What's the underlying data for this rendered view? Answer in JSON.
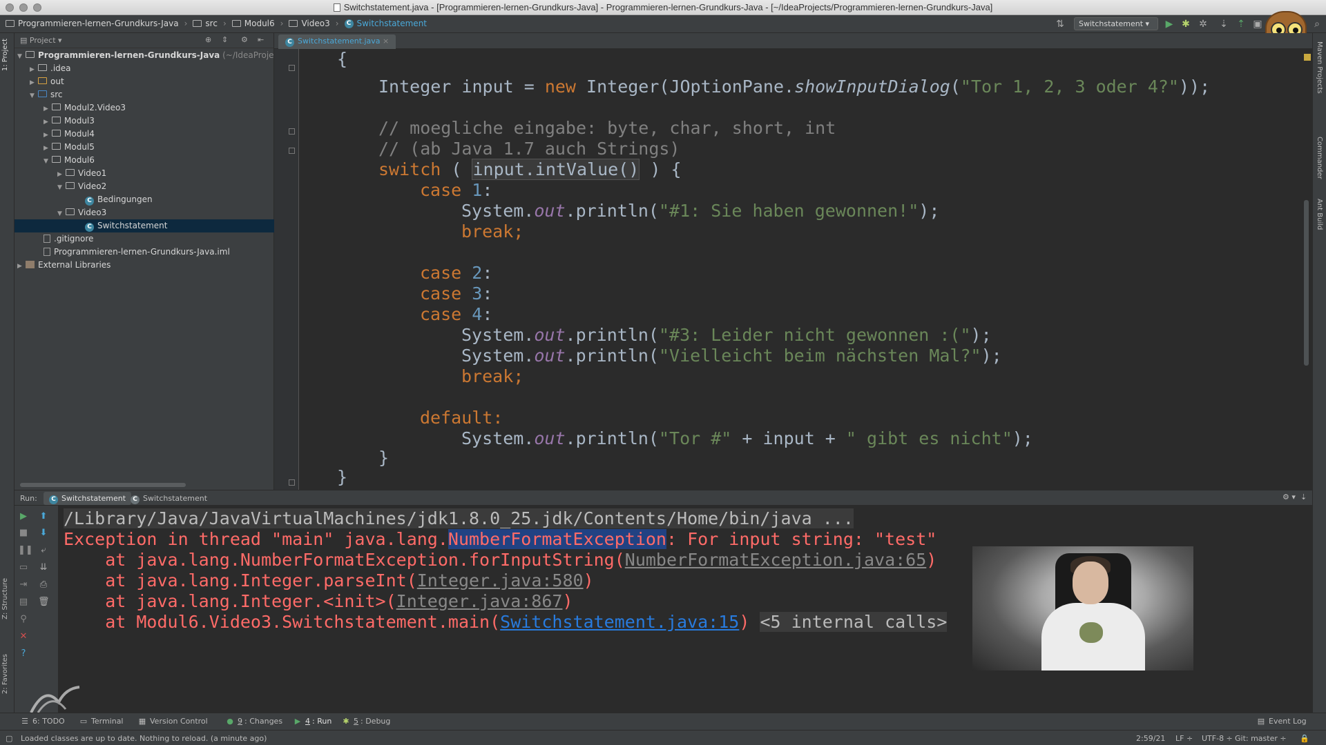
{
  "window": {
    "title": "Switchstatement.java - [Programmieren-lernen-Grundkurs-Java] - Programmieren-lernen-Grundkurs-Java - [~/IdeaProjects/Programmieren-lernen-Grundkurs-Java]"
  },
  "navbar": {
    "crumbs": [
      "Programmieren-lernen-Grundkurs-Java",
      "src",
      "Modul6",
      "Video3",
      "Switchstatement"
    ],
    "run_config": "Switchstatement"
  },
  "left_strip": {
    "project_tab": "1: Project",
    "structure_tab": "Z: Structure",
    "favorites_tab": "2: Favorites"
  },
  "right_strip": {
    "maven_tab": "Maven Projects",
    "commander_tab": "Commander",
    "ant_tab": "Ant Build"
  },
  "project": {
    "header": "Project",
    "root_name": "Programmieren-lernen-Grundkurs-Java",
    "root_path": "(~/IdeaProjec",
    "items": [
      {
        "label": ".idea"
      },
      {
        "label": "out"
      },
      {
        "label": "src"
      },
      {
        "label": "Modul2.Video3"
      },
      {
        "label": "Modul3"
      },
      {
        "label": "Modul4"
      },
      {
        "label": "Modul5"
      },
      {
        "label": "Modul6"
      },
      {
        "label": "Video1"
      },
      {
        "label": "Video2"
      },
      {
        "label": "Bedingungen"
      },
      {
        "label": "Video3"
      },
      {
        "label": "Switchstatement"
      },
      {
        "label": ".gitignore"
      },
      {
        "label": "Programmieren-lernen-Grundkurs-Java.iml"
      },
      {
        "label": "External Libraries"
      }
    ]
  },
  "editor": {
    "tab": "Switchstatement.java",
    "lines": {
      "l0": "{",
      "l1a": "Integer input = ",
      "l1b": "new",
      "l1c": " Integer(JOptionPane.",
      "l1d": "showInputDialog",
      "l1e": "(",
      "l1f": "\"Tor 1, 2, 3 oder 4?\"",
      "l1g": "));",
      "l2": "// moegliche eingabe: byte, char, short, int",
      "l3": "// (ab Java 1.7 auch Strings)",
      "l4a": "switch",
      "l4b": " ( ",
      "l4c": "input.intValue()",
      "l4d": " ) {",
      "case": "case",
      "n1": "1",
      "n2": "2",
      "n3": "3",
      "n4": "4",
      "colon": ":",
      "sys": "System.",
      "out": "out",
      "println": ".println(",
      "s1": "\"#1: Sie haben gewonnen!\"",
      "s3": "\"#3: Leider nicht gewonnen :(\"",
      "s4": "\"Vielleicht beim nächsten Mal?\"",
      "end": ");",
      "brk": "break;",
      "def": "default:",
      "s5a": "\"Tor #\"",
      "s5b": " + input + ",
      "s5c": "\" gibt es nicht\"",
      "close1": "}",
      "close2": "}"
    }
  },
  "run": {
    "label": "Run:",
    "tabs": [
      "Switchstatement",
      "Switchstatement"
    ],
    "console": {
      "cmd": "/Library/Java/JavaVirtualMachines/jdk1.8.0_25.jdk/Contents/Home/bin/java ...",
      "ex_a": "Exception in thread \"main\" java.lang.",
      "ex_b": "NumberFormatException",
      "ex_c": ": For input string: \"test\"",
      "t1a": "    at java.lang.NumberFormatException.forInputString(",
      "t1b": "NumberFormatException.java:65",
      "t1c": ")",
      "t2a": "    at java.lang.Integer.parseInt(",
      "t2b": "Integer.java:580",
      "t2c": ")",
      "t3a": "    at java.lang.Integer.<init>(",
      "t3b": "Integer.java:867",
      "t3c": ")",
      "t4a": "    at Modul6.Video3.Switchstatement.main(",
      "t4b": "Switchstatement.java:15",
      "t4c": ") ",
      "t4d": "<5 internal calls>"
    }
  },
  "bottom_tabs": {
    "todo": "6: TODO",
    "terminal": "Terminal",
    "vcs": "Version Control",
    "changes_u": "9",
    "changes": ": Changes",
    "run_u": "4",
    "run": ": Run",
    "debug_u": "5",
    "debug": ": Debug",
    "event_log": "Event Log"
  },
  "status": {
    "message": "Loaded classes are up to date. Nothing to reload. (a minute ago)",
    "position": "2:59/21",
    "line_sep": "LF ÷",
    "encoding": "UTF-8 ÷",
    "git": "Git: master ÷"
  }
}
